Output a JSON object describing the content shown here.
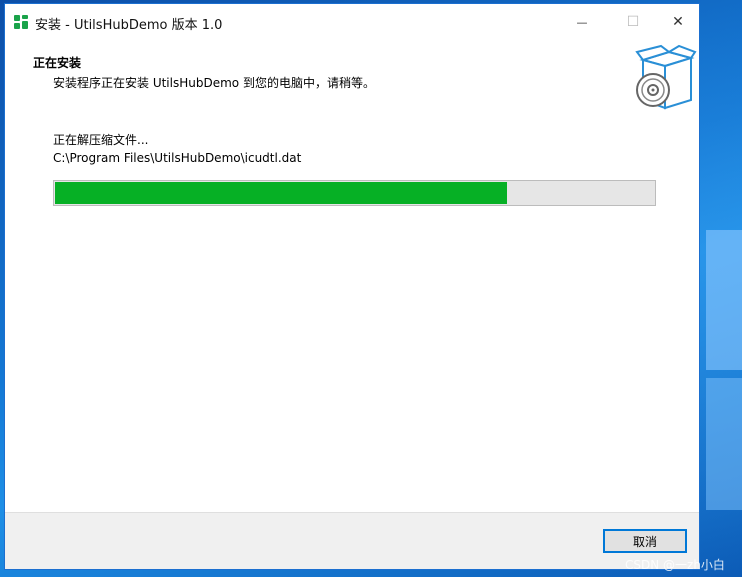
{
  "window": {
    "title": "安装 - UtilsHubDemo 版本 1.0",
    "minimize_glyph": "—",
    "maximize_glyph": "☐",
    "close_glyph": "✕"
  },
  "header": {
    "title": "正在安装",
    "subtitle": "安装程序正在安装 UtilsHubDemo 到您的电脑中，请稍等。",
    "image_icon": "software-box-icon"
  },
  "main": {
    "status_label": "正在解压缩文件...",
    "current_file": "C:\\Program Files\\UtilsHubDemo\\icudtl.dat",
    "progress_fraction": 0.755
  },
  "footer": {
    "cancel_label": "取消"
  },
  "watermark": "CSDN @一zh小白",
  "colors": {
    "progress_fill": "#06b025",
    "accent_border": "#0078d7",
    "app_icon": "#1aa34a"
  }
}
